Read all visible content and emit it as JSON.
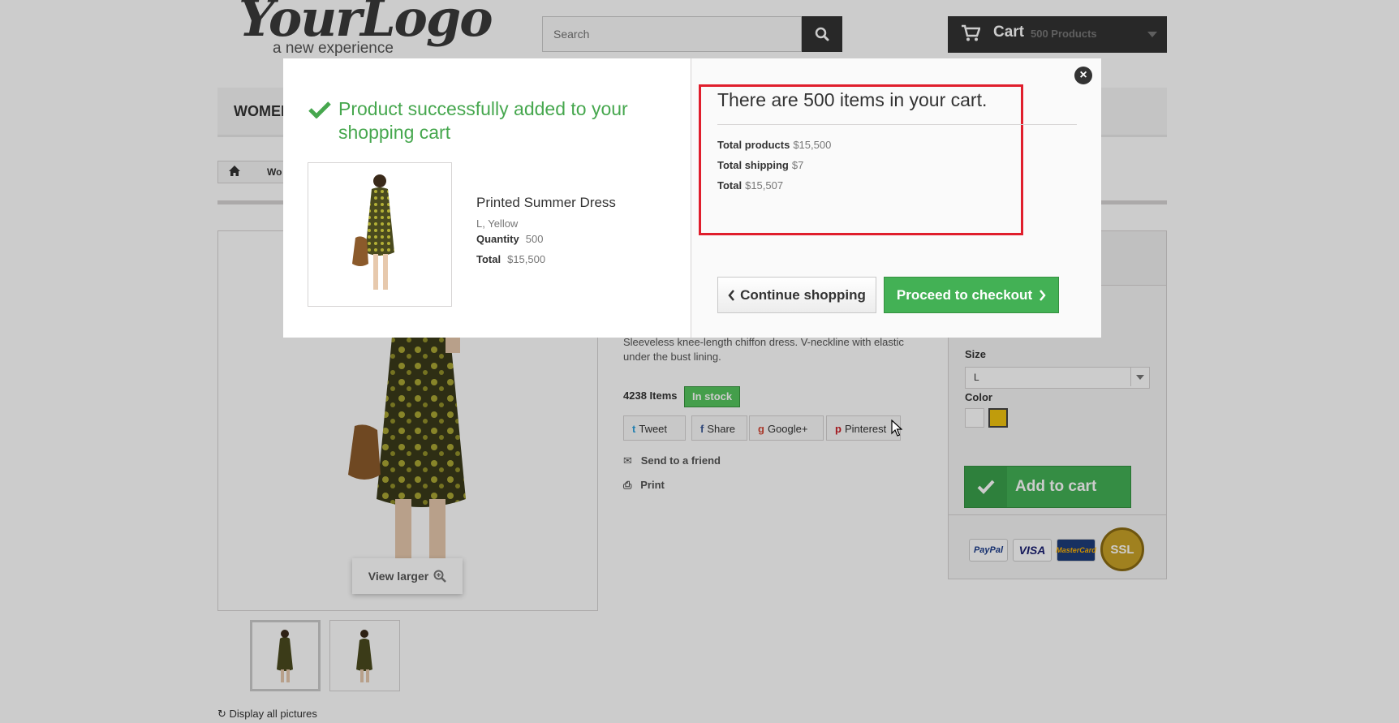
{
  "header": {
    "logo_main": "YourLogo",
    "logo_sub": "a new experience",
    "search_placeholder": "Search",
    "cart_label": "Cart",
    "cart_count": "500 Products"
  },
  "menu": {
    "first_item": "WOMEN"
  },
  "breadcrumb": {
    "text": "Wo"
  },
  "product_page": {
    "view_larger": "View larger",
    "display_all": "Display all pictures",
    "description": "Sleeveless knee-length chiffon dress. V-neckline with elastic under the bust lining.",
    "stock_count": "4238 Items",
    "stock_badge": "In stock",
    "social": {
      "tweet": "Tweet",
      "share": "Share",
      "gplus": "Google+",
      "pinterest": "Pinterest"
    },
    "send_friend": "Send to a friend",
    "print": "Print",
    "size_label": "Size",
    "size_value": "L",
    "color_label": "Color",
    "add_to_cart": "Add to cart",
    "payment": {
      "paypal": "PayPal",
      "visa": "VISA",
      "mastercard": "MasterCard",
      "ssl": "SSL"
    }
  },
  "modal": {
    "success_title": "Product successfully added to your shopping cart",
    "product_name": "Printed Summer Dress",
    "product_attrs": "L, Yellow",
    "quantity_label": "Quantity",
    "quantity_value": "500",
    "total_label": "Total",
    "total_value": "$15,500",
    "cart_heading": "There are 500 items in your cart.",
    "total_products_label": "Total products",
    "total_products_value": "$15,500",
    "total_shipping_label": "Total shipping",
    "total_shipping_value": "$7",
    "grand_total_label": "Total",
    "grand_total_value": "$15,507",
    "continue_label": "Continue shopping",
    "checkout_label": "Proceed to checkout"
  },
  "colors": {
    "success_green": "#46a74e",
    "button_green": "#43b155",
    "highlight_red": "#e01e2c",
    "dark": "#333333"
  },
  "icons": [
    "check-icon",
    "close-icon",
    "cart-icon",
    "search-icon",
    "home-icon",
    "zoom-icon",
    "mail-icon",
    "print-icon",
    "chevron-left-icon",
    "chevron-right-icon"
  ]
}
